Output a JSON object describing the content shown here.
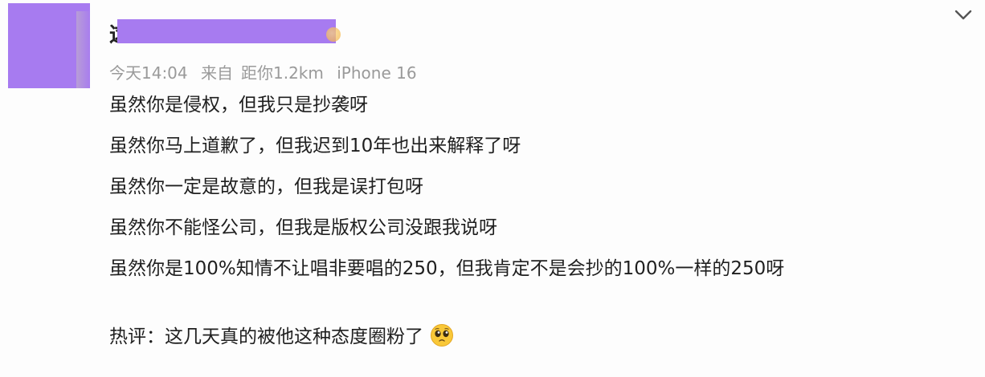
{
  "post": {
    "username_visible_char": "这",
    "meta": {
      "time": "今天14:04",
      "source": "来自",
      "distance": "距你1.2km",
      "device": "iPhone 16"
    },
    "lines": [
      "虽然你是侵权，但我只是抄袭呀",
      "虽然你马上道歉了，但我迟到10年也出来解释了呀",
      "虽然你一定是故意的，但我是误打包呀",
      "虽然你不能怪公司，但我是版权公司没跟我说呀",
      "虽然你是100%知情不让唱非要唱的250，但我肯定不是会抄的100%一样的250呀"
    ],
    "hot_comment": "热评：这几天真的被他这种态度圈粉了",
    "emoji_name": "pleading-face-emoji"
  },
  "icons": {
    "more": "chevron-down-icon"
  },
  "colors": {
    "avatar_cover": "#a77bf0",
    "meta_text": "#9a9a9a",
    "body_text": "#1f1f1f"
  }
}
